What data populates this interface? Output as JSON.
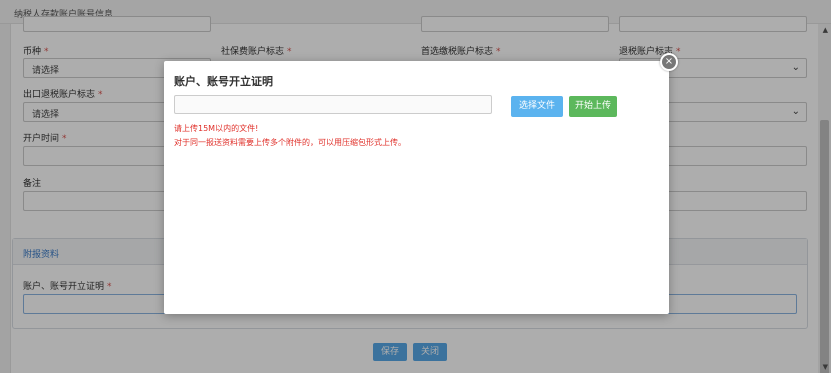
{
  "window": {
    "title": "纳税人存款账户账号信息"
  },
  "form": {
    "currency_label": "币种",
    "social_security_label": "社保费账户标志",
    "preferred_tax_label": "首选缴税账户标志",
    "refund_label": "退税账户标志",
    "currency_select": "请选择",
    "export_refund_label": "出口退税账户标志",
    "export_refund_select": "请选择",
    "open_time_label": "开户时间",
    "remark_label": "备注",
    "required_mark": "*"
  },
  "attachments": {
    "section_title": "附报资料",
    "cert_label": "账户、账号开立证明"
  },
  "buttons": {
    "save": "保存",
    "close": "关闭"
  },
  "modal": {
    "title": "账户、账号开立证明",
    "choose_file": "选择文件",
    "start_upload": "开始上传",
    "note_size": "请上传15M以内的文件!",
    "note_zip": "对于同一报送资料需要上传多个附件的，可以用压缩包形式上传。",
    "close_glyph": "×"
  },
  "icons": {
    "chevron": "chevron-down-icon",
    "close": "close-icon"
  },
  "colors": {
    "primary_button": "#57a8e8",
    "upload_button": "#5cb85c",
    "required": "#d9534f",
    "note_text": "#e0302a"
  }
}
